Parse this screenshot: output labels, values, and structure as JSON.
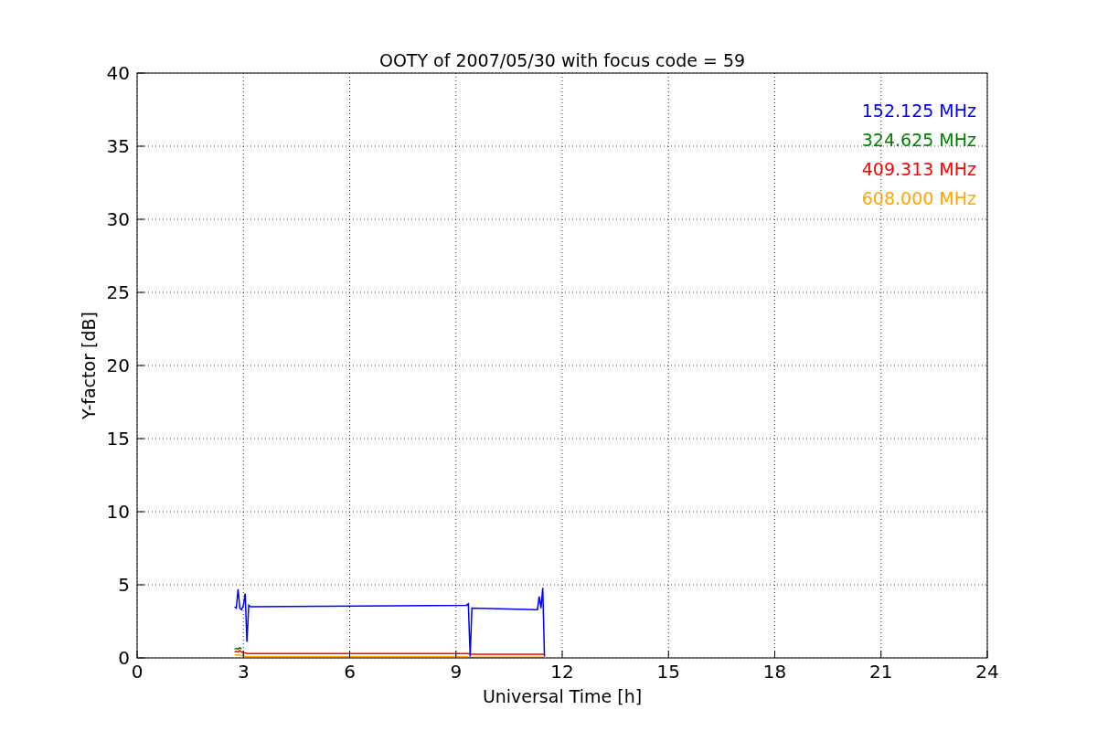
{
  "chart_data": {
    "type": "line",
    "title": "OOTY of 2007/05/30 with focus code = 59",
    "xlabel": "Universal Time [h]",
    "ylabel": "Y-factor [dB]",
    "x": [
      2.75,
      2.8,
      2.85,
      2.9,
      2.95,
      3.0,
      3.05,
      3.1,
      3.15,
      3.2,
      9.3,
      9.35,
      9.4,
      9.45,
      11.3,
      11.35,
      11.4,
      11.45,
      11.5
    ],
    "series": [
      {
        "name": "152.125 MHz",
        "color": "#0000ff",
        "values": [
          3.5,
          3.4,
          4.7,
          3.4,
          3.3,
          3.6,
          4.4,
          1.1,
          3.6,
          3.5,
          3.6,
          3.7,
          0.1,
          3.4,
          3.3,
          4.2,
          3.4,
          4.8,
          0.1
        ]
      },
      {
        "name": "324.625 MHz",
        "color": "#008000",
        "values": [
          0.6,
          0.65,
          0.6,
          0.7,
          0.6,
          null,
          null,
          null,
          null,
          null,
          null,
          null,
          null,
          null,
          null,
          null,
          null,
          null,
          null
        ]
      },
      {
        "name": "409.313 MHz",
        "color": "#ff0000",
        "values": [
          0.4,
          0.45,
          0.4,
          0.5,
          0.4,
          0.35,
          0.35,
          0.3,
          0.3,
          0.3,
          0.3,
          0.3,
          0.25,
          0.25,
          0.25,
          0.25,
          0.25,
          0.25,
          0.25
        ]
      },
      {
        "name": "608.000 MHz",
        "color": "#ffa500",
        "values": [
          0.2,
          0.2,
          0.2,
          0.2,
          0.15,
          0.15,
          0.1,
          0.1,
          0.1,
          0.1,
          0.1,
          0.05,
          0.05,
          0.05,
          0.05,
          0.05,
          0.05,
          0.05,
          0.05
        ]
      }
    ],
    "xlim": [
      0,
      24
    ],
    "ylim": [
      0,
      40
    ],
    "xticks": [
      0,
      3,
      6,
      9,
      12,
      15,
      18,
      21,
      24
    ],
    "yticks": [
      0,
      5,
      10,
      15,
      20,
      25,
      30,
      35,
      40
    ],
    "grid": true
  }
}
